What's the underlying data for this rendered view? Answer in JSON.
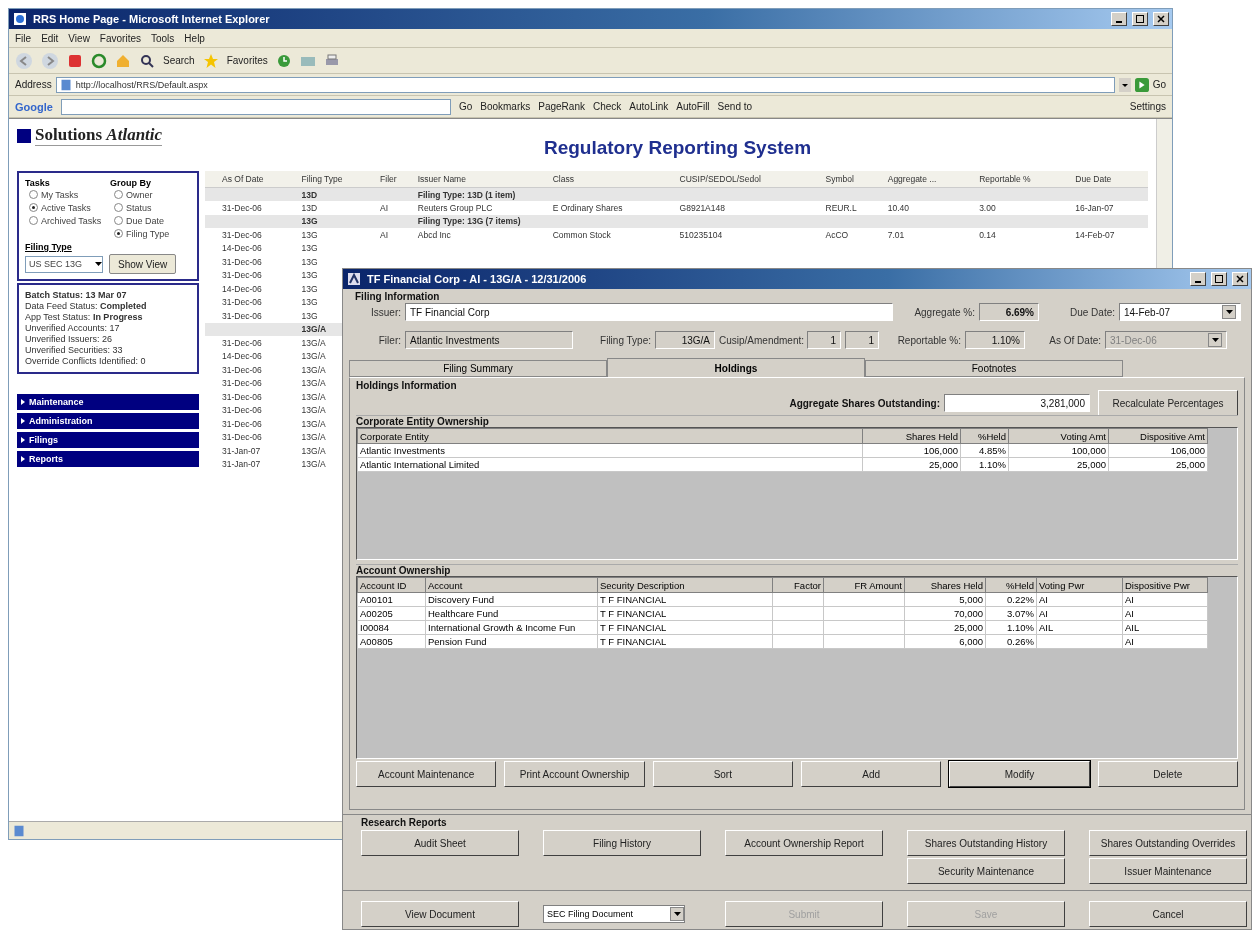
{
  "browser": {
    "title": "RRS Home Page - Microsoft Internet Explorer",
    "menu": [
      "File",
      "Edit",
      "View",
      "Favorites",
      "Tools",
      "Help"
    ],
    "toolbar": {
      "search": "Search",
      "favorites": "Favorites"
    },
    "address": {
      "label": "Address",
      "value": "http://localhost/RRS/Default.aspx",
      "go": "Go"
    },
    "google_bar": {
      "logo": "Google",
      "go": "Go",
      "items": [
        "Bookmarks",
        "PageRank",
        "Check",
        "AutoLink",
        "AutoFill",
        "Send to"
      ],
      "settings": "Settings"
    },
    "page": {
      "logo": "Solutions *Atlantic*",
      "heading": "Regulatory Reporting System",
      "tasks": {
        "label": "Tasks",
        "options": [
          {
            "label": "My Tasks",
            "selected": false
          },
          {
            "label": "Active Tasks",
            "selected": true
          },
          {
            "label": "Archived Tasks",
            "selected": false
          }
        ]
      },
      "group_by": {
        "label": "Group By",
        "options": [
          {
            "label": "Owner",
            "selected": false
          },
          {
            "label": "Status",
            "selected": false
          },
          {
            "label": "Due Date",
            "selected": false
          },
          {
            "label": "Filing Type",
            "selected": true
          }
        ]
      },
      "filing_type": {
        "label": "Filing Type",
        "value": "US SEC 13G"
      },
      "show_view": "Show View",
      "status_lines": [
        "**Batch Status: 13 Mar 07**",
        "Data Feed Status: **Completed**",
        "App Test Status: **In Progress**",
        "Unverified Accounts: 17",
        "Unverified Issuers: 26",
        "Unverified Securities: 33",
        "Override Conflicts Identified: 0"
      ],
      "nav": [
        "Maintenance",
        "Administration",
        "Filings",
        "Reports"
      ],
      "table": {
        "columns": [
          "As Of Date",
          "Filing Type",
          "Filer",
          "Issuer Name",
          "Class",
          "CUSIP/SEDOL/Sedol",
          "Symbol",
          "Aggregate ...",
          "Reportable %",
          "Due Date"
        ],
        "rows": [
          {
            "kind": "group",
            "label": "13D",
            "caption": "Filing Type: 13D (1 item)"
          },
          {
            "kind": "item",
            "cells": [
              "31-Dec-06",
              "13D",
              "AI",
              "Reuters Group PLC",
              "E Ordinary Shares",
              "G8921A148",
              "REUR.L",
              "10.40",
              "3.00",
              "16-Jan-07"
            ]
          },
          {
            "kind": "group",
            "label": "13G",
            "caption": "Filing Type: 13G (7 items)"
          },
          {
            "kind": "item",
            "cells": [
              "31-Dec-06",
              "13G",
              "AI",
              "Abcd Inc",
              "Common Stock",
              "510235104",
              "AcCO",
              "7.01",
              "0.14",
              "14-Feb-07"
            ]
          },
          {
            "kind": "item",
            "cells": [
              "14-Dec-06",
              "13G"
            ]
          },
          {
            "kind": "item",
            "cells": [
              "31-Dec-06",
              "13G"
            ]
          },
          {
            "kind": "item",
            "cells": [
              "31-Dec-06",
              "13G"
            ]
          },
          {
            "kind": "item",
            "cells": [
              "14-Dec-06",
              "13G"
            ]
          },
          {
            "kind": "item",
            "cells": [
              "31-Dec-06",
              "13G"
            ]
          },
          {
            "kind": "item",
            "cells": [
              "31-Dec-06",
              "13G"
            ]
          },
          {
            "kind": "group",
            "label": "13G/A"
          },
          {
            "kind": "item",
            "cells": [
              "31-Dec-06",
              "13G/A"
            ]
          },
          {
            "kind": "item",
            "cells": [
              "14-Dec-06",
              "13G/A"
            ]
          },
          {
            "kind": "item",
            "cells": [
              "31-Dec-06",
              "13G/A"
            ]
          },
          {
            "kind": "item",
            "cells": [
              "31-Dec-06",
              "13G/A"
            ]
          },
          {
            "kind": "item",
            "cells": [
              "31-Dec-06",
              "13G/A"
            ]
          },
          {
            "kind": "item",
            "cells": [
              "31-Dec-06",
              "13G/A"
            ]
          },
          {
            "kind": "item",
            "cells": [
              "31-Dec-06",
              "13G/A"
            ]
          },
          {
            "kind": "item",
            "cells": [
              "31-Dec-06",
              "13G/A"
            ]
          },
          {
            "kind": "item",
            "cells": [
              "31-Jan-07",
              "13G/A"
            ]
          },
          {
            "kind": "item",
            "cells": [
              "31-Jan-07",
              "13G/A"
            ]
          }
        ]
      }
    }
  },
  "dialog": {
    "title": "TF Financial Corp - AI - 13G/A - 12/31/2006",
    "filing_info": {
      "heading": "Filing Information",
      "issuer": {
        "label": "Issuer:",
        "value": "TF Financial Corp"
      },
      "aggregate": {
        "label": "Aggregate %:",
        "value": "6.69%"
      },
      "due_date": {
        "label": "Due Date:",
        "value": "14-Feb-07"
      },
      "filer": {
        "label": "Filer:",
        "value": "Atlantic Investments"
      },
      "filing_type": {
        "label": "Filing Type:",
        "value": "13G/A"
      },
      "cusip": {
        "label": "Cusip/Amendment:",
        "values": [
          "1",
          "1"
        ]
      },
      "reportable": {
        "label": "Reportable %:",
        "value": "1.10%"
      },
      "as_of_date": {
        "label": "As Of Date:",
        "value": "31-Dec-06",
        "disabled": true
      }
    },
    "tabs": [
      {
        "label": "Filing Summary",
        "selected": false
      },
      {
        "label": "Holdings",
        "selected": true
      },
      {
        "label": "Footnotes",
        "selected": false
      }
    ],
    "holdings": {
      "heading": "Holdings Information",
      "shares_outstanding": {
        "label": "Aggregate Shares Outstanding:",
        "value": "3,281,000"
      },
      "recalculate": "Recalculate Percentages",
      "corporate": {
        "heading": "Corporate Entity Ownership",
        "columns": [
          "Corporate Entity",
          "Shares Held",
          "%Held",
          "Voting Amt",
          "Dispositive Amt"
        ],
        "rows": [
          [
            "Atlantic Investments",
            "106,000",
            "4.85%",
            "100,000",
            "106,000"
          ],
          [
            "Atlantic International Limited",
            "25,000",
            "1.10%",
            "25,000",
            "25,000"
          ]
        ]
      },
      "accounts": {
        "heading": "Account Ownership",
        "columns": [
          "Account ID",
          "Account",
          "Security Description",
          "Factor",
          "FR Amount",
          "Shares Held",
          "%Held",
          "Voting Pwr",
          "Dispositive Pwr"
        ],
        "rows": [
          [
            "A00101",
            "Discovery Fund",
            "T F FINANCIAL",
            "",
            "",
            "5,000",
            "0.22%",
            "AI",
            "AI"
          ],
          [
            "A00205",
            "Healthcare Fund",
            "T F FINANCIAL",
            "",
            "",
            "70,000",
            "3.07%",
            "AI",
            "AI"
          ],
          [
            "I00084",
            "International Growth & Income Fun",
            "T F FINANCIAL",
            "",
            "",
            "25,000",
            "1.10%",
            "AIL",
            "AIL"
          ],
          [
            "A00805",
            "Pension Fund",
            "T F FINANCIAL",
            "",
            "",
            "6,000",
            "0.26%",
            "",
            "AI"
          ]
        ]
      },
      "buttons": [
        {
          "label": "Account Maintenance",
          "focused": false
        },
        {
          "label": "Print Account Ownership",
          "focused": false
        },
        {
          "label": "Sort",
          "focused": false
        },
        {
          "label": "Add",
          "focused": false
        },
        {
          "label": "Modify",
          "focused": true
        },
        {
          "label": "Delete",
          "focused": false
        }
      ]
    },
    "research": {
      "heading": "Research Reports",
      "row1": [
        "Audit Sheet",
        "Filing History",
        "Account Ownership Report",
        "Shares Outstanding History",
        "Shares Outstanding Overrides"
      ],
      "row2": [
        "Security Maintenance",
        "Issuer Maintenance"
      ]
    },
    "footer": {
      "view_document": "View Document",
      "document_type": "SEC Filing Document",
      "buttons": [
        {
          "label": "Submit",
          "disabled": true
        },
        {
          "label": "Save",
          "disabled": true
        },
        {
          "label": "Cancel",
          "disabled": false
        }
      ]
    }
  }
}
